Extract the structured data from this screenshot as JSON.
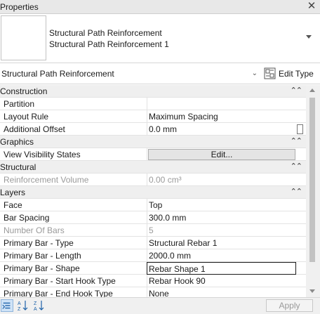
{
  "window": {
    "title": "Properties"
  },
  "type_selector": {
    "family": "Structural Path Reinforcement",
    "type": "Structural Path Reinforcement 1"
  },
  "instance_filter": {
    "selected": "Structural Path Reinforcement",
    "edit_type_label": "Edit Type"
  },
  "properties": {
    "construction": {
      "label": "Construction",
      "partition": {
        "name": "Partition",
        "value": ""
      },
      "layout_rule": {
        "name": "Layout Rule",
        "value": "Maximum Spacing"
      },
      "additional_offset": {
        "name": "Additional Offset",
        "value": "0.0 mm"
      }
    },
    "graphics": {
      "label": "Graphics",
      "view_visibility_states": {
        "name": "View Visibility States",
        "value": "Edit..."
      }
    },
    "structural": {
      "label": "Structural",
      "reinforcement_volume": {
        "name": "Reinforcement Volume",
        "value": "0.00 cm³"
      }
    },
    "layers": {
      "label": "Layers",
      "face": {
        "name": "Face",
        "value": "Top"
      },
      "bar_spacing": {
        "name": "Bar Spacing",
        "value": "300.0 mm"
      },
      "number_of_bars": {
        "name": "Number Of Bars",
        "value": "5"
      },
      "primary_bar_type": {
        "name": "Primary Bar - Type",
        "value": "Structural Rebar 1"
      },
      "primary_bar_length": {
        "name": "Primary Bar - Length",
        "value": "2000.0 mm"
      },
      "primary_bar_shape": {
        "name": "Primary Bar - Shape",
        "value": "Rebar Shape 1"
      },
      "primary_bar_start_hook_type": {
        "name": "Primary Bar - Start Hook Type",
        "value": "Rebar Hook 90"
      },
      "primary_bar_end_hook_type": {
        "name": "Primary Bar - End Hook Type",
        "value": "None"
      }
    }
  },
  "footer": {
    "apply_label": "Apply"
  },
  "colors": {
    "accent": "#cfe3f7",
    "category_bg": "#efefef"
  }
}
